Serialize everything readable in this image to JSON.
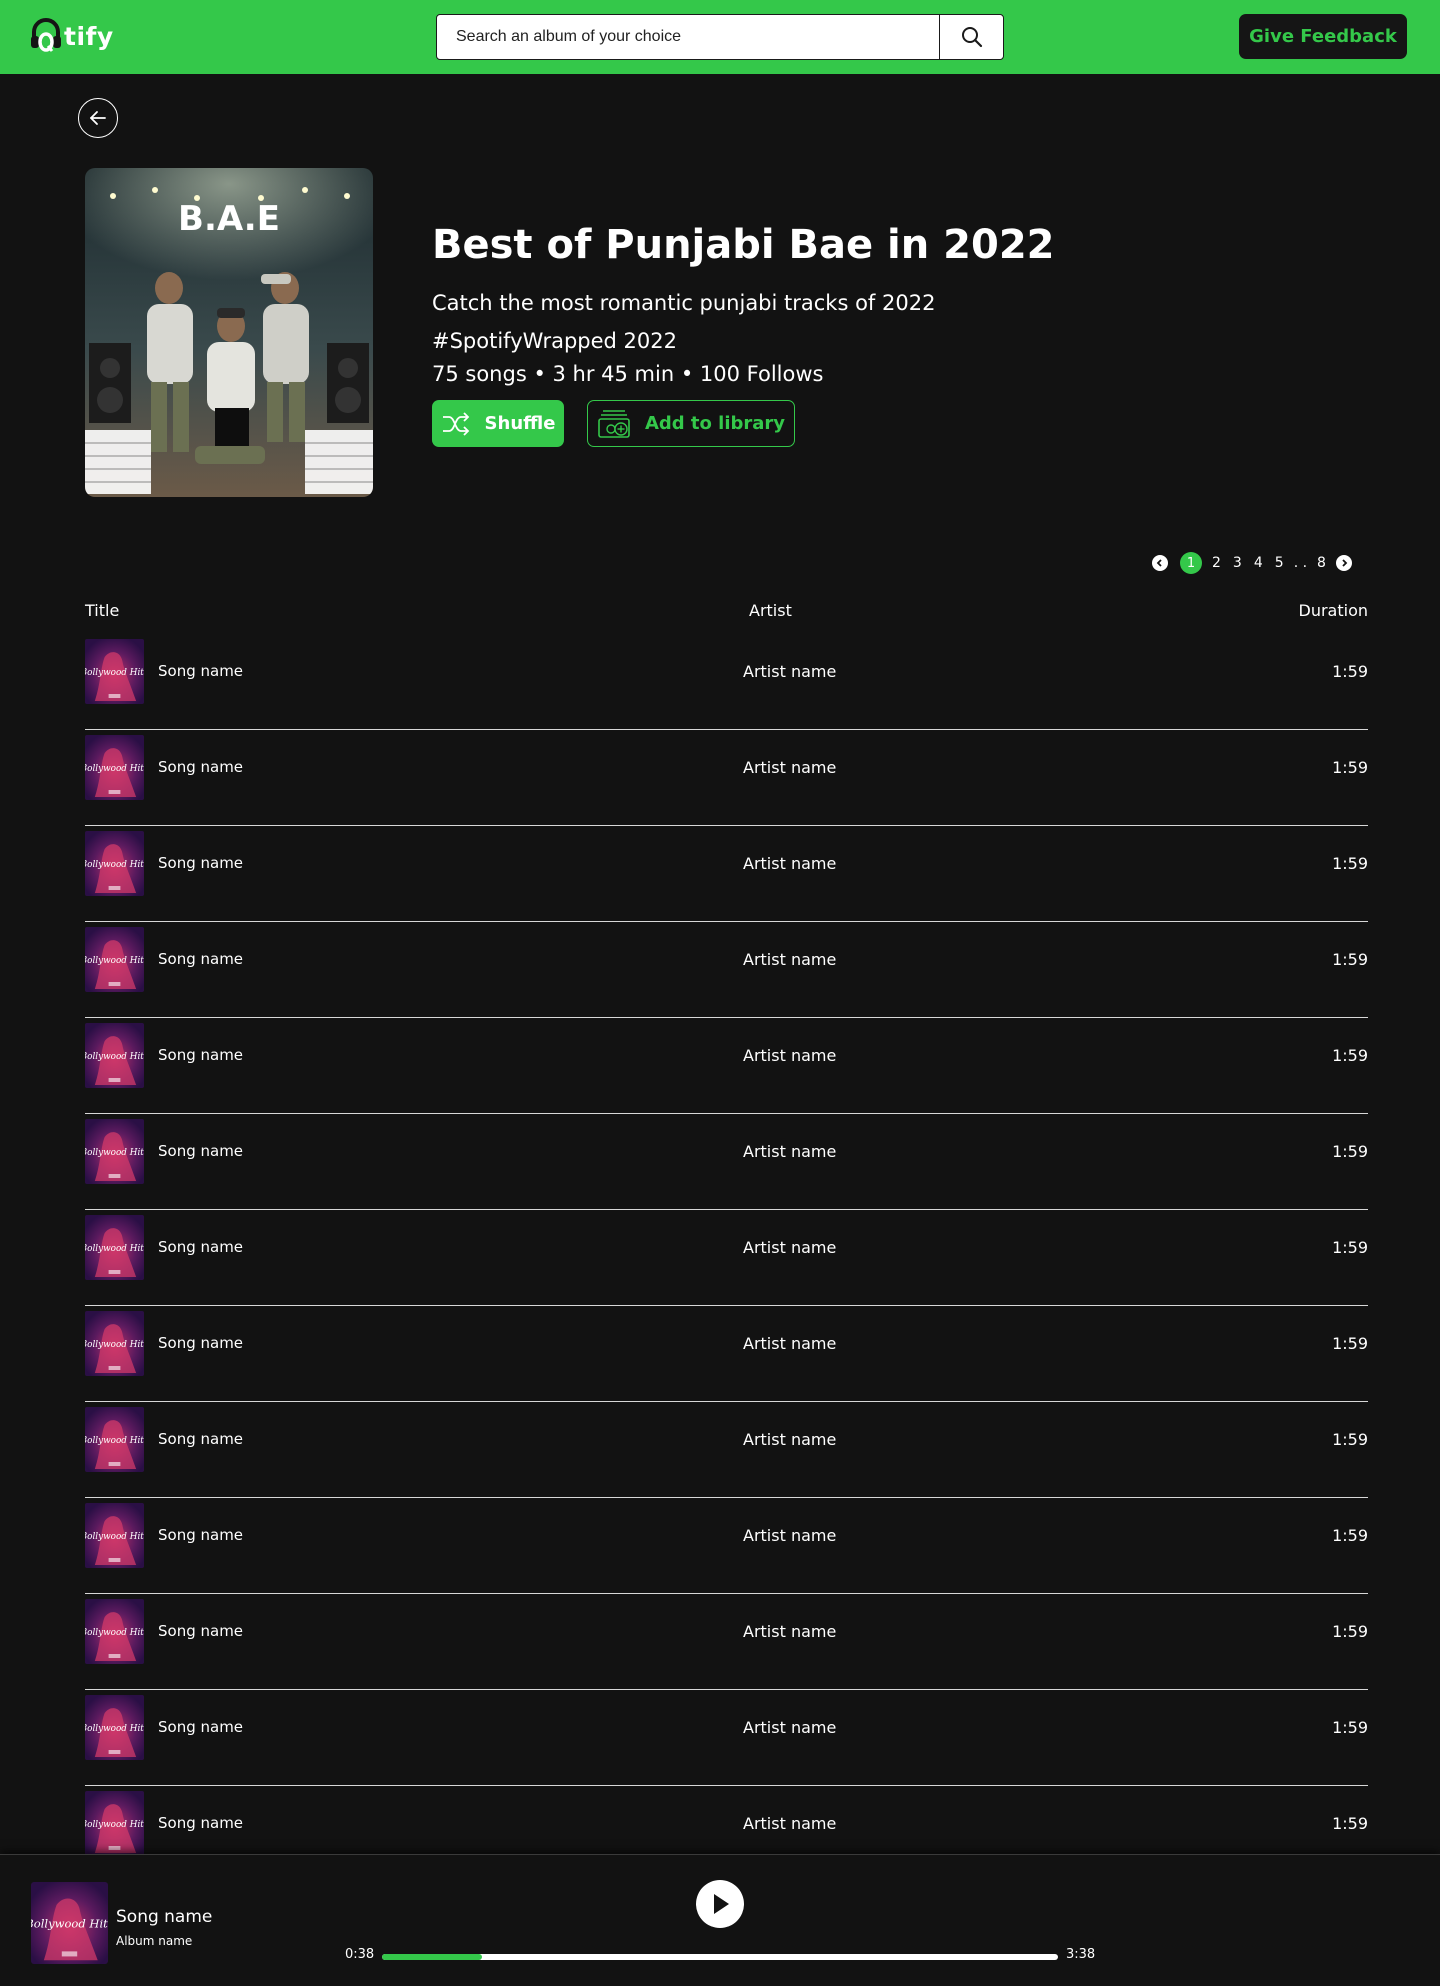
{
  "header": {
    "logo_text": "tify",
    "search_placeholder": "Search an album of your choice",
    "feedback_label": "Give Feedback"
  },
  "album": {
    "cover_label": "B.A.E",
    "title": "Best of Punjabi Bae in 2022",
    "description": "Catch the most romantic punjabi tracks of 2022 #SpotifyWrapped 2022",
    "meta": "75 songs • 3 hr 45 min • 100 Follows",
    "shuffle_label": "Shuffle",
    "library_label": "Add to library"
  },
  "pagination": {
    "pages": [
      "1",
      "2",
      "3",
      "4",
      "5",
      ". .",
      "8"
    ],
    "current": "1"
  },
  "table": {
    "headers": {
      "title": "Title",
      "artist": "Artist",
      "duration": "Duration"
    },
    "thumb_label": "Bollywood Hits",
    "rows": [
      {
        "song": "Song name",
        "artist": "Artist name",
        "duration": "1:59"
      },
      {
        "song": "Song name",
        "artist": "Artist name",
        "duration": "1:59"
      },
      {
        "song": "Song name",
        "artist": "Artist name",
        "duration": "1:59"
      },
      {
        "song": "Song name",
        "artist": "Artist name",
        "duration": "1:59"
      },
      {
        "song": "Song name",
        "artist": "Artist name",
        "duration": "1:59"
      },
      {
        "song": "Song name",
        "artist": "Artist name",
        "duration": "1:59"
      },
      {
        "song": "Song name",
        "artist": "Artist name",
        "duration": "1:59"
      },
      {
        "song": "Song name",
        "artist": "Artist name",
        "duration": "1:59"
      },
      {
        "song": "Song name",
        "artist": "Artist name",
        "duration": "1:59"
      },
      {
        "song": "Song name",
        "artist": "Artist name",
        "duration": "1:59"
      },
      {
        "song": "Song name",
        "artist": "Artist name",
        "duration": "1:59"
      },
      {
        "song": "Song name",
        "artist": "Artist name",
        "duration": "1:59"
      },
      {
        "song": "Song name",
        "artist": "Artist name",
        "duration": "1:59"
      }
    ]
  },
  "player": {
    "song": "Song name",
    "album": "Album name",
    "current_time": "0:38",
    "total_time": "3:38",
    "progress_fraction": 0.148
  },
  "colors": {
    "accent": "#34c84a",
    "background": "#121212",
    "text": "#ffffff"
  },
  "icons": {
    "logo": "headphones-icon",
    "search": "search-icon",
    "back": "arrow-left-icon",
    "shuffle": "shuffle-icon",
    "library": "library-add-icon",
    "prev_page": "chevron-left-icon",
    "next_page": "chevron-right-icon",
    "play": "play-icon"
  }
}
